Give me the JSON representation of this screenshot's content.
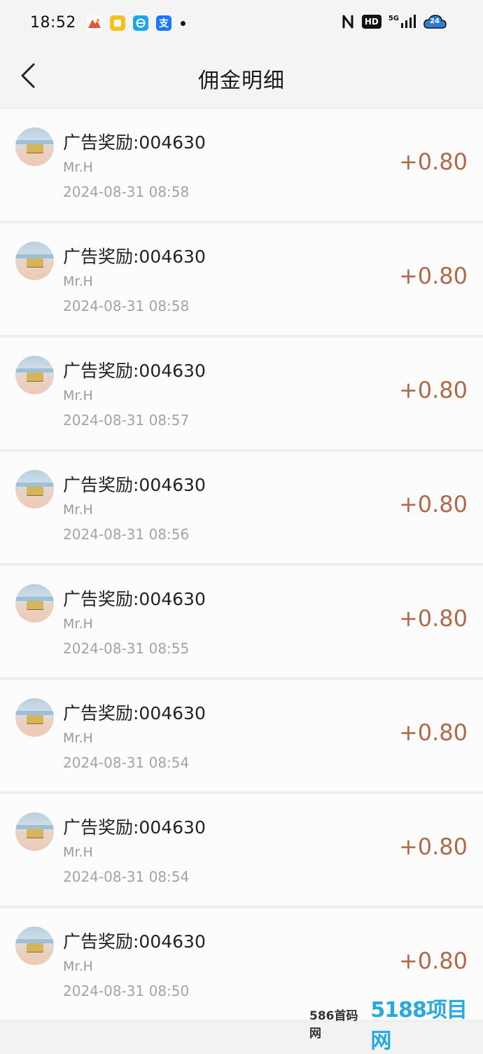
{
  "status_bar": {
    "time": "18:52",
    "app_icons": [
      "photo-app-icon",
      "notes-app-icon",
      "browser-app-icon",
      "alipay-app-icon"
    ],
    "alipay_glyph": "支",
    "hd_label": "HD",
    "network_label": "5G",
    "cloud_badge": "24"
  },
  "nav": {
    "title": "佣金明细"
  },
  "items": [
    {
      "title": "广告奖励:004630",
      "user": "Mr.H",
      "date": "2024-08-31 08:58",
      "amount": "+0.80"
    },
    {
      "title": "广告奖励:004630",
      "user": "Mr.H",
      "date": "2024-08-31 08:58",
      "amount": "+0.80"
    },
    {
      "title": "广告奖励:004630",
      "user": "Mr.H",
      "date": "2024-08-31 08:57",
      "amount": "+0.80"
    },
    {
      "title": "广告奖励:004630",
      "user": "Mr.H",
      "date": "2024-08-31 08:56",
      "amount": "+0.80"
    },
    {
      "title": "广告奖励:004630",
      "user": "Mr.H",
      "date": "2024-08-31 08:55",
      "amount": "+0.80"
    },
    {
      "title": "广告奖励:004630",
      "user": "Mr.H",
      "date": "2024-08-31 08:54",
      "amount": "+0.80"
    },
    {
      "title": "广告奖励:004630",
      "user": "Mr.H",
      "date": "2024-08-31 08:54",
      "amount": "+0.80"
    },
    {
      "title": "广告奖励:004630",
      "user": "Mr.H",
      "date": "2024-08-31 08:50",
      "amount": "+0.80"
    }
  ],
  "watermark": {
    "text1": "586首码网",
    "text2": "5188项目网"
  },
  "colors": {
    "amount": "#b06a4a",
    "background": "#f2f2f2",
    "card": "#fdfcfc"
  }
}
